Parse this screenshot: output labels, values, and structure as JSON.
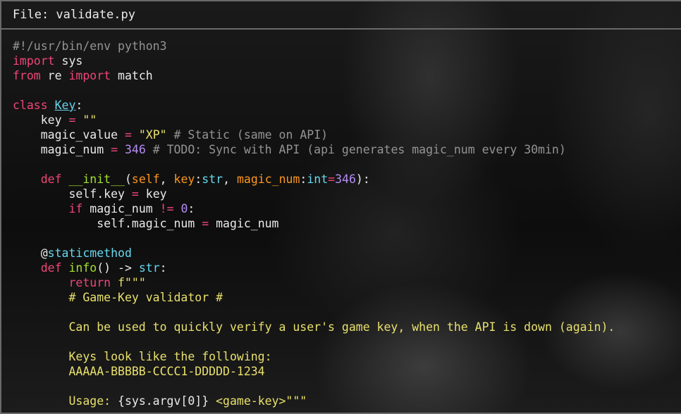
{
  "window": {
    "title": "File: validate.py"
  },
  "code": {
    "language": "python",
    "lines": [
      [
        {
          "t": "#!/usr/bin/env python3",
          "c": "cmt"
        }
      ],
      [
        {
          "t": "import",
          "c": "kw"
        },
        {
          "t": " sys",
          "c": "plain"
        }
      ],
      [
        {
          "t": "from",
          "c": "kw"
        },
        {
          "t": " re ",
          "c": "plain"
        },
        {
          "t": "import",
          "c": "kw"
        },
        {
          "t": " match",
          "c": "plain"
        }
      ],
      [],
      [
        {
          "t": "class",
          "c": "kw"
        },
        {
          "t": " ",
          "c": "plain"
        },
        {
          "t": "Key",
          "c": "cls"
        },
        {
          "t": ":",
          "c": "plain"
        }
      ],
      [
        {
          "t": "    key ",
          "c": "plain"
        },
        {
          "t": "=",
          "c": "kw"
        },
        {
          "t": " ",
          "c": "plain"
        },
        {
          "t": "\"\"",
          "c": "str"
        }
      ],
      [
        {
          "t": "    magic_value ",
          "c": "plain"
        },
        {
          "t": "=",
          "c": "kw"
        },
        {
          "t": " ",
          "c": "plain"
        },
        {
          "t": "\"XP\"",
          "c": "str"
        },
        {
          "t": " # Static (same on API)",
          "c": "cmt"
        }
      ],
      [
        {
          "t": "    magic_num ",
          "c": "plain"
        },
        {
          "t": "=",
          "c": "kw"
        },
        {
          "t": " ",
          "c": "plain"
        },
        {
          "t": "346",
          "c": "num"
        },
        {
          "t": " # TODO: Sync with API (api generates magic_num every 30min)",
          "c": "cmt"
        }
      ],
      [],
      [
        {
          "t": "    ",
          "c": "plain"
        },
        {
          "t": "def",
          "c": "kw"
        },
        {
          "t": " ",
          "c": "plain"
        },
        {
          "t": "__init__",
          "c": "fn"
        },
        {
          "t": "(",
          "c": "plain"
        },
        {
          "t": "self",
          "c": "param"
        },
        {
          "t": ", ",
          "c": "plain"
        },
        {
          "t": "key",
          "c": "param"
        },
        {
          "t": ":",
          "c": "plain"
        },
        {
          "t": "str",
          "c": "builtin"
        },
        {
          "t": ", ",
          "c": "plain"
        },
        {
          "t": "magic_num",
          "c": "param"
        },
        {
          "t": ":",
          "c": "plain"
        },
        {
          "t": "int",
          "c": "builtin"
        },
        {
          "t": "=",
          "c": "kw"
        },
        {
          "t": "346",
          "c": "num"
        },
        {
          "t": "):",
          "c": "plain"
        }
      ],
      [
        {
          "t": "        self.key ",
          "c": "plain"
        },
        {
          "t": "=",
          "c": "kw"
        },
        {
          "t": " key",
          "c": "plain"
        }
      ],
      [
        {
          "t": "        ",
          "c": "plain"
        },
        {
          "t": "if",
          "c": "kw"
        },
        {
          "t": " magic_num ",
          "c": "plain"
        },
        {
          "t": "!=",
          "c": "kw"
        },
        {
          "t": " ",
          "c": "plain"
        },
        {
          "t": "0",
          "c": "num"
        },
        {
          "t": ":",
          "c": "plain"
        }
      ],
      [
        {
          "t": "            self.magic_num ",
          "c": "plain"
        },
        {
          "t": "=",
          "c": "kw"
        },
        {
          "t": " magic_num",
          "c": "plain"
        }
      ],
      [],
      [
        {
          "t": "    @",
          "c": "plain"
        },
        {
          "t": "staticmethod",
          "c": "deco"
        }
      ],
      [
        {
          "t": "    ",
          "c": "plain"
        },
        {
          "t": "def",
          "c": "kw"
        },
        {
          "t": " ",
          "c": "plain"
        },
        {
          "t": "info",
          "c": "fn"
        },
        {
          "t": "() -> ",
          "c": "plain"
        },
        {
          "t": "str",
          "c": "builtin"
        },
        {
          "t": ":",
          "c": "plain"
        }
      ],
      [
        {
          "t": "        ",
          "c": "plain"
        },
        {
          "t": "return",
          "c": "kw"
        },
        {
          "t": " ",
          "c": "plain"
        },
        {
          "t": "f\"\"\"",
          "c": "str"
        }
      ],
      [
        {
          "t": "        # Game-Key validator #",
          "c": "str"
        }
      ],
      [],
      [
        {
          "t": "        Can be used to quickly verify a user's game key, when the API is down (again).",
          "c": "str"
        }
      ],
      [],
      [
        {
          "t": "        Keys look like the following:",
          "c": "str"
        }
      ],
      [
        {
          "t": "        AAAAA-BBBBB-CCCC1-DDDDD-1234",
          "c": "str"
        }
      ],
      [],
      [
        {
          "t": "        Usage: ",
          "c": "str"
        },
        {
          "t": "{sys.argv[0]}",
          "c": "plain"
        },
        {
          "t": " <game-key>\"\"\"",
          "c": "str"
        }
      ]
    ]
  },
  "colors": {
    "keyword": "#f0457a",
    "class_name": "#67d3ec",
    "string": "#e8e06c",
    "comment": "#949494",
    "number": "#b58cf6",
    "function": "#a6e22e",
    "parameter": "#fd971f",
    "builtin": "#66d9ef",
    "plain": "#eaeaea",
    "border": "#6a6a6a"
  }
}
